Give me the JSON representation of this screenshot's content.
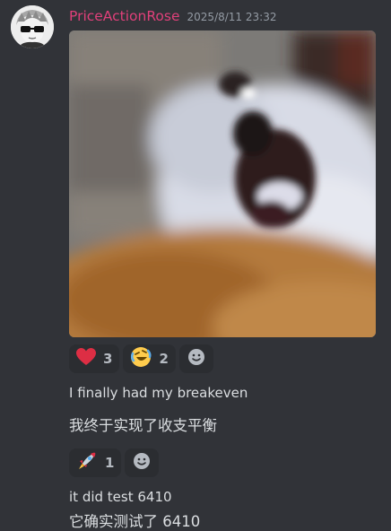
{
  "message": {
    "username": "PriceActionRose",
    "timestamp": "2025/8/11 23:32",
    "username_color": "#e0407a"
  },
  "reactions_1": [
    {
      "emoji": "red-heart-icon",
      "count": "3"
    },
    {
      "emoji": "rolling-laughing-icon",
      "count": "2"
    }
  ],
  "lines": {
    "line1": "I finally had my breakeven",
    "line2": "我终于实现了收支平衡",
    "line3": "it did test 6410",
    "line4": "它确实测试了 6410"
  },
  "reactions_2": [
    {
      "emoji": "rocket-icon",
      "count": "1"
    }
  ]
}
